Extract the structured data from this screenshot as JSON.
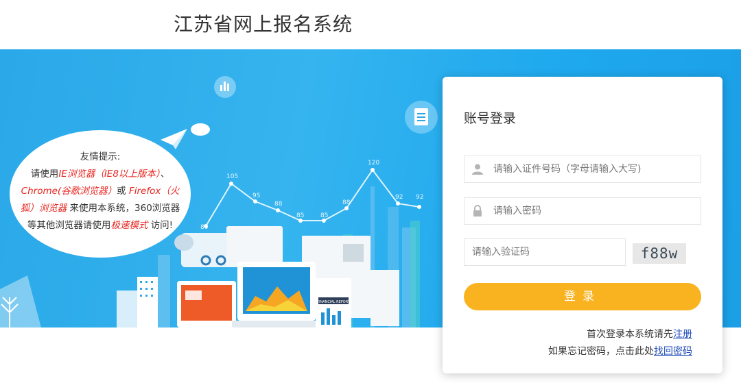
{
  "header": {
    "title": "江苏省网上报名系统"
  },
  "tip": {
    "heading": "友情提示:",
    "line2_pre": "请使用",
    "line2_red": "IE浏览器（IE8以上版本）",
    "line2_post": "、",
    "line3_red1": "Chrome(谷歌浏览器）",
    "line3_mid": "或 ",
    "line3_red2": "Firefox（火",
    "line4_red": "狐）浏览器",
    "line4_post": " 来使用本系统，360浏览器",
    "line5_pre": "等其他浏览器请使用",
    "line5_red": "极速模式",
    "line5_post": " 访问!"
  },
  "illustration": {
    "chart_values": [
      "105",
      "95",
      "88",
      "85",
      "85",
      "88",
      "120",
      "92",
      "92",
      "80"
    ],
    "report_label": "FINANCIAL REPORT"
  },
  "login": {
    "title": "账号登录",
    "id_placeholder": "请输入证件号码（字母请输入大写)",
    "password_placeholder": "请输入密码",
    "captcha_placeholder": "请输入验证码",
    "captcha_text": "f88w",
    "button_label": "登录",
    "register_pre": "首次登录本系统请先",
    "register_link": "注册",
    "forgot_pre": "如果忘记密码，点击此处",
    "forgot_link": "找回密码"
  },
  "colors": {
    "banner": "#2aa8e8",
    "button": "#fab320",
    "link": "#1c4bb8",
    "highlight": "#e8231d"
  },
  "icons": [
    "user-icon",
    "lock-icon",
    "bar-chart-icon",
    "document-icon",
    "paper-plane-icon"
  ]
}
